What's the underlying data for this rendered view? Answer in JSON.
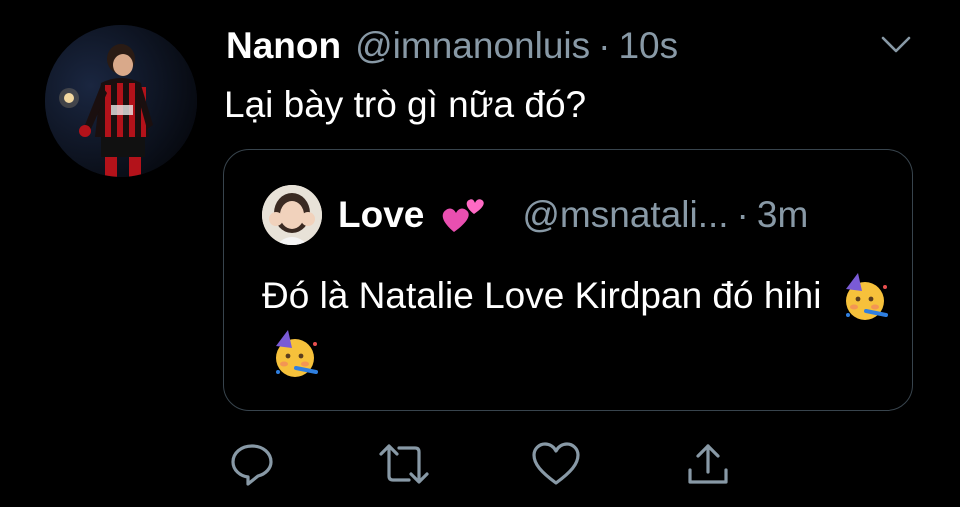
{
  "tweet": {
    "author_name": "Nanon",
    "author_handle": "@imnanonluis",
    "separator": "·",
    "time": "10s",
    "text": "Lại bày trò gì nữa đó?"
  },
  "quoted_tweet": {
    "author_name": "Love",
    "author_handle": "@msnatali...",
    "separator": "·",
    "time": "3m",
    "text": "Đó là Natalie Love Kirdpan đó hihi",
    "emoji_after_name": "two-hearts-icon",
    "emojis_after_text": [
      "partying-face-icon",
      "partying-face-icon"
    ]
  },
  "actions": [
    "reply-icon",
    "retweet-icon",
    "like-icon",
    "share-icon"
  ],
  "colors": {
    "background": "#000000",
    "text": "#ffffff",
    "muted": "#8899a6",
    "border": "#38444d"
  }
}
